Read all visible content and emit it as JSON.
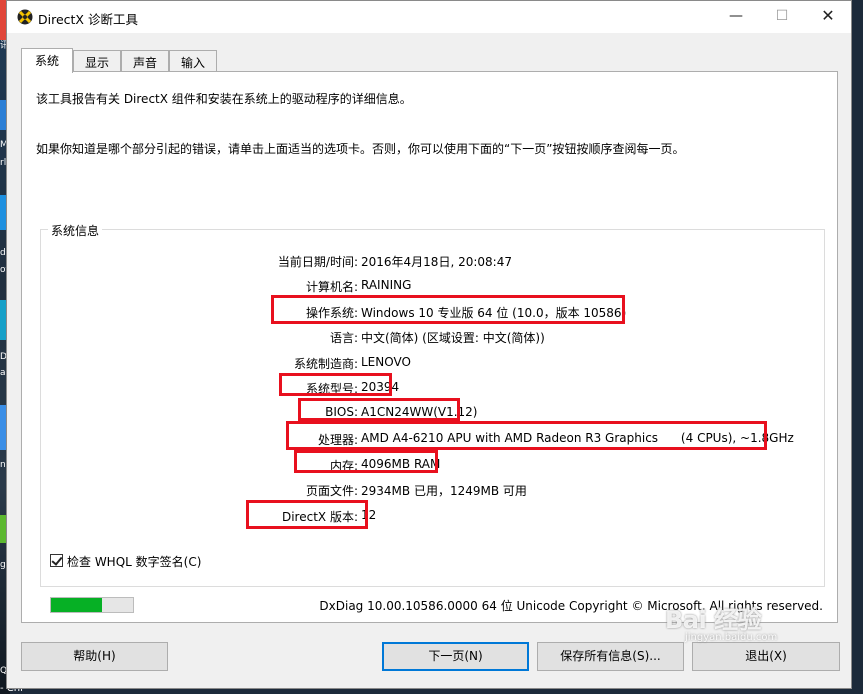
{
  "window": {
    "title": "DirectX 诊断工具",
    "min_glyph": "—",
    "max_glyph": "☐",
    "close_glyph": "✕"
  },
  "tabs": [
    {
      "label": "系统",
      "active": true
    },
    {
      "label": "显示",
      "active": false
    },
    {
      "label": "声音",
      "active": false
    },
    {
      "label": "输入",
      "active": false
    }
  ],
  "intro": {
    "line1": "该工具报告有关 DirectX 组件和安装在系统上的驱动程序的详细信息。",
    "line2": "如果你知道是哪个部分引起的错误，请单击上面适当的选项卡。否则，你可以使用下面的“下一页”按钮按顺序查阅每一页。"
  },
  "sysinfo": {
    "group_label": "系统信息",
    "rows": [
      {
        "label": "当前日期/时间:",
        "value": "2016年4月18日, 20:08:47"
      },
      {
        "label": "计算机名:",
        "value": "RAINING"
      },
      {
        "label": "操作系统:",
        "value": "Windows 10 专业版 64 位 (10.0，版本 10586)"
      },
      {
        "label": "语言:",
        "value": "中文(简体) (区域设置: 中文(简体))"
      },
      {
        "label": "系统制造商:",
        "value": "LENOVO"
      },
      {
        "label": "系统型号:",
        "value": "20394"
      },
      {
        "label": "BIOS:",
        "value": "A1CN24WW(V1.12)"
      },
      {
        "label": "处理器:",
        "value": "AMD A4-6210 APU with AMD Radeon R3 Graphics      (4 CPUs), ~1.8GHz"
      },
      {
        "label": "内存:",
        "value": "4096MB RAM"
      },
      {
        "label": "页面文件:",
        "value": "2934MB 已用，1249MB 可用"
      },
      {
        "label": "DirectX 版本:",
        "value": "12"
      }
    ]
  },
  "whql": {
    "label": "检查 WHQL 数字签名(C)",
    "checked": true
  },
  "progress": {
    "fraction": 0.62
  },
  "footer": {
    "version_text": "DxDiag 10.00.10586.0000 64 位 Unicode  Copyright © Microsoft. All rights reserved."
  },
  "buttons": {
    "help": "帮助(H)",
    "next": "下一页(N)",
    "save": "保存所有信息(S)...",
    "exit": "退出(X)"
  },
  "watermark": {
    "brand": "Bai 经验",
    "url": "jingyan.baidu.com"
  },
  "desktop_fragments": [
    "讯",
    "M",
    "rl",
    "d",
    "ot",
    "D",
    "a",
    "nd",
    "g",
    "Q",
    "- Chi"
  ],
  "colors": {
    "highlight": "#e8101e",
    "progress": "#06b025",
    "accent": "#0078d7"
  }
}
